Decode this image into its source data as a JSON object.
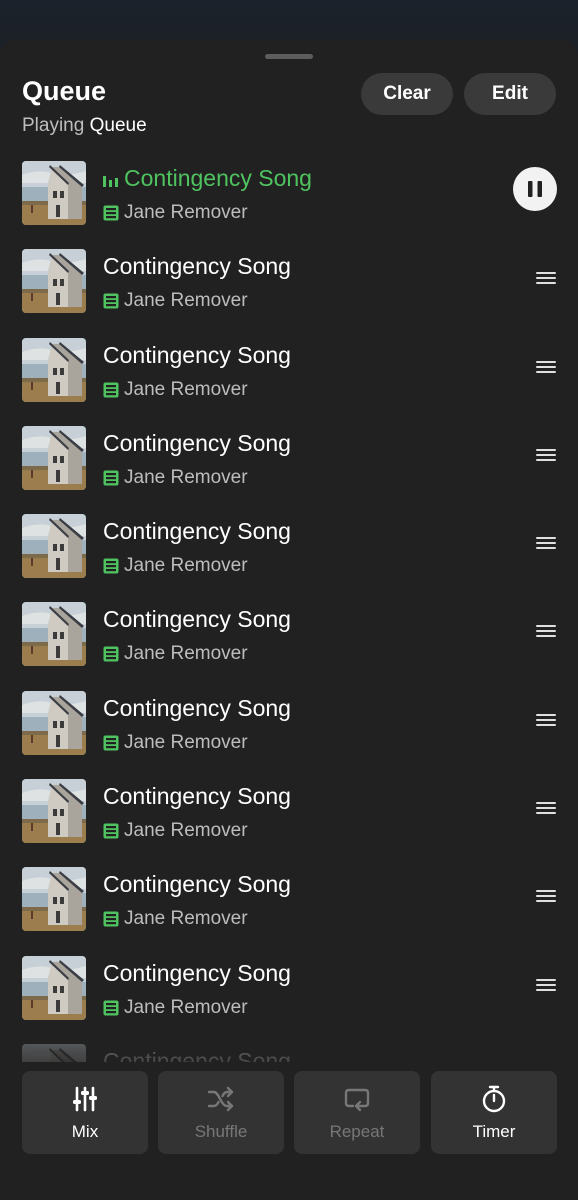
{
  "header": {
    "title": "Queue",
    "subtitle_prefix": "Playing",
    "subtitle_source": "Queue",
    "clear_label": "Clear",
    "edit_label": "Edit"
  },
  "now_playing": {
    "song": "Contingency Song",
    "artist": "Jane Remover",
    "accent": "#4fc35f"
  },
  "queue": [
    {
      "song": "Contingency Song",
      "artist": "Jane Remover"
    },
    {
      "song": "Contingency Song",
      "artist": "Jane Remover"
    },
    {
      "song": "Contingency Song",
      "artist": "Jane Remover"
    },
    {
      "song": "Contingency Song",
      "artist": "Jane Remover"
    },
    {
      "song": "Contingency Song",
      "artist": "Jane Remover"
    },
    {
      "song": "Contingency Song",
      "artist": "Jane Remover"
    },
    {
      "song": "Contingency Song",
      "artist": "Jane Remover"
    },
    {
      "song": "Contingency Song",
      "artist": "Jane Remover"
    },
    {
      "song": "Contingency Song",
      "artist": "Jane Remover"
    },
    {
      "song": "Contingency Song",
      "artist": "Jane Remover"
    }
  ],
  "controls": {
    "mix": {
      "label": "Mix",
      "icon": "sliders-icon",
      "enabled": true
    },
    "shuffle": {
      "label": "Shuffle",
      "icon": "shuffle-icon",
      "enabled": false
    },
    "repeat": {
      "label": "Repeat",
      "icon": "repeat-icon",
      "enabled": false
    },
    "timer": {
      "label": "Timer",
      "icon": "stopwatch-icon",
      "enabled": true
    }
  }
}
